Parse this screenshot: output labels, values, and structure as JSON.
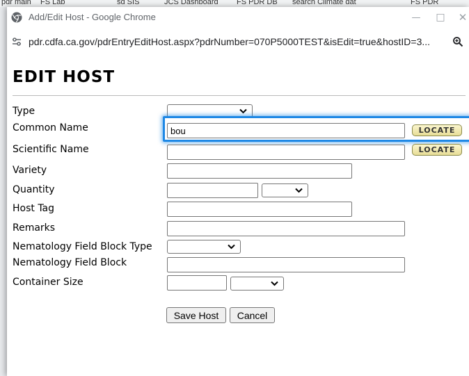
{
  "background": {
    "bookmarks": [
      "pdr main",
      "FS Lab",
      "sd SIS",
      "JCS Dashboard",
      "FS PDR DB",
      "search Climate dat",
      "FS PDR"
    ]
  },
  "window": {
    "title": "Add/Edit Host - Google Chrome",
    "url": "pdr.cdfa.ca.gov/pdrEntryEditHost.aspx?pdrNumber=070P5000TEST&isEdit=true&hostID=3...",
    "icons": {
      "app": "chrome-icon",
      "site": "site-settings-icon",
      "zoom": "zoom-icon"
    }
  },
  "page": {
    "title": "EDIT HOST"
  },
  "form": {
    "type": {
      "label": "Type",
      "value": ""
    },
    "common_name": {
      "label": "Common Name",
      "value": "bou"
    },
    "scientific_name": {
      "label": "Scientific Name",
      "value": ""
    },
    "variety": {
      "label": "Variety",
      "value": ""
    },
    "quantity": {
      "label": "Quantity",
      "value": "",
      "unit": ""
    },
    "host_tag": {
      "label": "Host Tag",
      "value": ""
    },
    "remarks": {
      "label": "Remarks",
      "value": ""
    },
    "nematology_field_block_type": {
      "label": "Nematology Field Block Type",
      "value": ""
    },
    "nematology_field_block": {
      "label": "Nematology Field Block",
      "value": ""
    },
    "container_size": {
      "label": "Container Size",
      "value": "",
      "unit": ""
    },
    "locate_label": "LOCATE",
    "save_label": "Save Host",
    "cancel_label": "Cancel"
  },
  "colors": {
    "highlight": "#1e88e5",
    "locate_bg": "#efe7a8"
  }
}
